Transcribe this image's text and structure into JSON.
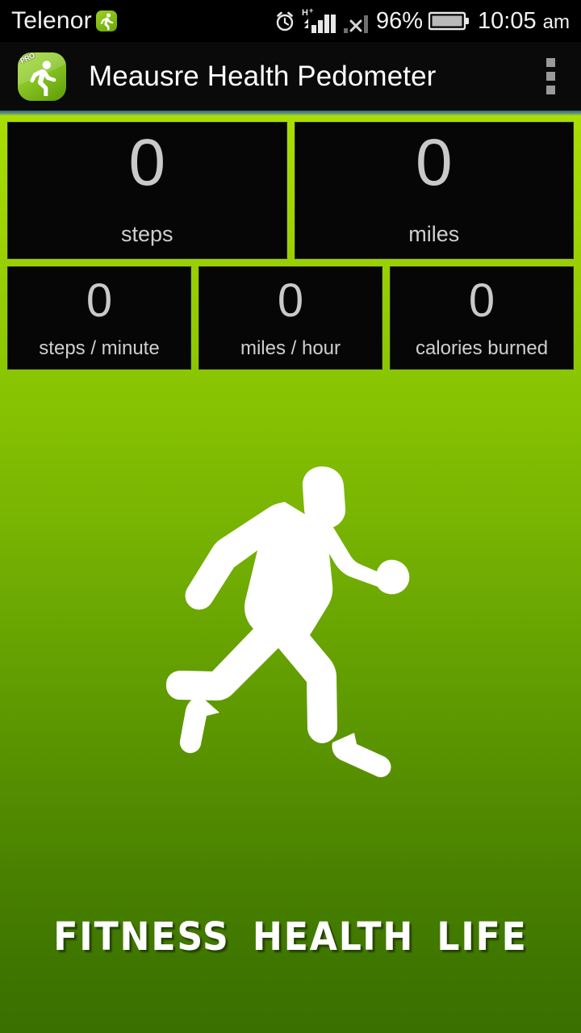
{
  "status_bar": {
    "carrier": "Telenor",
    "notification_icon": "pedometer-app-icon",
    "icons": [
      "alarm-clock-icon",
      "hsdpa-signal-icon",
      "sim2-no-signal-icon",
      "battery-icon"
    ],
    "network_label": "H+",
    "battery_percent": "96%",
    "clock_time": "10:05",
    "clock_meridiem": "am"
  },
  "action_bar": {
    "app_icon": "pedometer-app-icon",
    "app_icon_badge": "PRO",
    "title": "Meausre Health Pedometer",
    "overflow_icon": "overflow-menu-icon"
  },
  "stats": {
    "large": [
      {
        "value": "0",
        "label": "steps"
      },
      {
        "value": "0",
        "label": "miles"
      }
    ],
    "small": [
      {
        "value": "0",
        "label": "steps / minute"
      },
      {
        "value": "0",
        "label": "miles / hour"
      },
      {
        "value": "0",
        "label": "calories burned"
      }
    ]
  },
  "hero": {
    "artwork": "running-man-silhouette",
    "tagline": "FITNESS HEALTH LIFE"
  },
  "colors": {
    "accent_green_top": "#a9de03",
    "accent_green_bottom": "#397000",
    "panel_background": "#060606",
    "panel_text": "#c9c9c9",
    "status_bar_background": "#000000",
    "action_bar_background": "#0a0a0a",
    "rule_teal": "#4f8490"
  }
}
